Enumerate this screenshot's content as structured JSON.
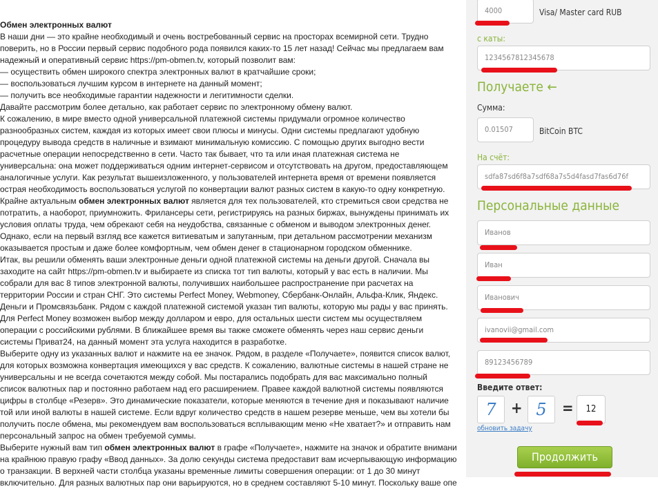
{
  "article": {
    "lines": [
      {
        "text": "Обмен электронных валют",
        "bold": true
      },
      {
        "text": "В наши дни — это крайне необходимый и очень востребованный сервис на просторах всемирной сети. Трудно"
      },
      {
        "text": "поверить, но в России первый сервис подобного рода появился каких-то 15 лет назад! Сейчас мы предлагаем вам"
      },
      {
        "text": "надежный и оперативный сервис https://pm-obmen.tv, который позволит вам:"
      },
      {
        "text": "— осуществить обмен широкого спектра электронных валют в кратчайшие сроки;"
      },
      {
        "text": "— воспользоваться лучшим курсом в интернете на данный момент;"
      },
      {
        "text": "— получить все необходимые гарантии надежности и легитимности сделки."
      },
      {
        "text": "Давайте рассмотрим более детально, как работает сервис по электронному обмену валют."
      },
      {
        "text": "К сожалению, в мире вместо одной универсальной платежной системы придумали огромное количество"
      },
      {
        "text": "разнообразных систем, каждая из которых имеет свои плюсы и минусы. Одни системы предлагают удобную"
      },
      {
        "text": "процедуру вывода средств в наличные и взимают минимальную комиссию. С помощью других выгодно вести"
      },
      {
        "text": "расчетные операции непосредственно в сети. Часто так бывает, что та или иная платежная система не"
      },
      {
        "text": "универсальна: она может поддерживаться одним интернет-сервисом и отсутствовать на другом, предоставляющем"
      },
      {
        "text": "аналогичные услуги. Как результат вышеизложенного, у пользователей интернета время от времени появляется"
      },
      {
        "text": "острая необходимость воспользоваться услугой по конвертации валют разных систем в какую-то одну конкретную."
      },
      {
        "pre": "Крайне актуальным ",
        "bold_mid": "обмен электронных валют",
        "post": " является для тех пользователей, кто стремиться свои средства не"
      },
      {
        "text": "потратить, а наоборот, приумножить. Фрилансеры сети, регистрируясь на разных биржах, вынуждены принимать их"
      },
      {
        "text": "условия оплаты труда, чем обрекают себя на неудобства, связанные с обменом и выводом электронных денег."
      },
      {
        "text": "Однако, если на первый взгляд все кажется витиеватым и запутанным, при детальном рассмотрении механизм"
      },
      {
        "text": "оказывается простым и даже более комфортным, чем обмен денег в стационарном городском обменнике."
      },
      {
        "text": "Итак, вы решили обменять ваши электронные деньги одной платежной системы на деньги другой. Сначала вы"
      },
      {
        "text": "заходите на сайт https://pm-obmen.tv и выбираете из списка тот тип валюты, который у вас есть в наличии. Мы"
      },
      {
        "text": "собрали для вас 8 типов электронной валюты, получивших наибольшее распространение при расчетах на"
      },
      {
        "text": "территории России и стран СНГ. Это системы Perfect Money, Webmoney,  Сбербанк-Онлайн, Альфа-Клик, Яндекс."
      },
      {
        "text": "Деньги и Промсвязьбанк. Рядом с каждой платежной системой указан тип валюты, которую мы рады у вас принять."
      },
      {
        "text": "Для Perfect Money возможен выбор между долларом и евро, для остальных шести систем мы осуществляем"
      },
      {
        "text": "операции с российскими рублями. В ближайшее время вы также сможете обменять через наш сервис деньги"
      },
      {
        "text": "системы Приват24, на данный момент эта услуга находится в разработке."
      },
      {
        "text": "Выберите одну из указанных валют и нажмите на ее значок. Рядом, в разделе «Получаете», появится список валют,"
      },
      {
        "text": "для которых возможна конвертация имеющихся у вас средств. К сожалению, валютные системы в нашей стране не"
      },
      {
        "text": "универсальны и не всегда сочетаются между собой. Мы постарались подобрать для вас максимально полный"
      },
      {
        "text": "список валютных пар и постоянно работаем над его расширением. Правее каждой валютной системы появляются"
      },
      {
        "text": "цифры в столбце «Резерв». Это динамические показатели, которые меняются в течение дня и показывают наличие"
      },
      {
        "text": "той или иной валюты в нашей системе. Если вдруг количество средств в нашем резерве меньше, чем вы хотели бы"
      },
      {
        "text": "получить после обмена, мы рекомендуем вам воспользоваться всплывающим меню «Не хватает?» и отправить нам"
      },
      {
        "text": "персональный запрос на обмен требуемой суммы."
      },
      {
        "pre": "Выберите нужный вам тип ",
        "bold_mid": "обмен электронных валют",
        "post": " в графе «Получаете», нажмите на значок и обратите внимание"
      },
      {
        "text": "на крайнюю правую графу «Ввод данных». За долю секунды система предоставит вам исчерпывающую информацию"
      },
      {
        "text": "о транзакции. В верхней части столбца указаны временные лимиты совершения операции: от 1 до 30 минут"
      },
      {
        "text": "включительно. Для разных валютных пар они варьируются, но в среднем составляют 5-10 минут. Поскольку ваше операция"
      }
    ]
  },
  "form": {
    "amount_give": "4000",
    "currency_give": "Visa/ Master card RUB",
    "from_card_label": "с каты:",
    "from_card_value": "1234567812345678",
    "receive_heading": "Получаете ←",
    "sum_label": "Сумма:",
    "amount_receive": "0.01507",
    "currency_receive": "BitCoin BTC",
    "to_account_label": "На счёт:",
    "to_account_value": "sdfa87sd6f8a7sdf68a7s5d4fasd7fas6d76f",
    "personal_heading": "Персональные данные",
    "last_name": "Иванов",
    "first_name": "Иван",
    "patronymic": "Иванович",
    "email": "ivanovii@gmail.com",
    "phone": "89123456789",
    "captcha_label": "Введите ответ:",
    "captcha_a": "7",
    "captcha_plus": "+",
    "captcha_b": "5",
    "captcha_eq": "=",
    "captcha_answer": "12",
    "refresh_link": "обновить задачу",
    "submit_label": "Продолжить"
  },
  "colors": {
    "accent_green": "#8ab43a",
    "annotation_red": "#e8111a",
    "link_blue": "#3a7cc4"
  }
}
